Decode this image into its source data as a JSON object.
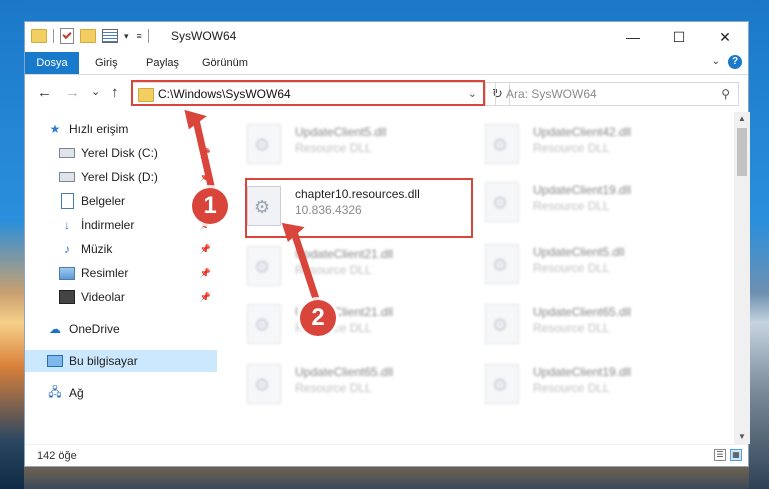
{
  "window": {
    "title": "SysWOW64",
    "controls": {
      "minimize": "—",
      "maximize": "☐",
      "close": "✕"
    }
  },
  "ribbon": {
    "tabs": [
      "Dosya",
      "Giriş",
      "Paylaş",
      "Görünüm"
    ],
    "help": "?"
  },
  "nav": {
    "back": "←",
    "forward": "→",
    "recent": "⌄",
    "up": "↑",
    "address": "C:\\Windows\\SysWOW64",
    "refresh": "↻",
    "search_placeholder": "Ara: SysWOW64"
  },
  "sidebar": {
    "quick_access": "Hızlı erişim",
    "items": [
      {
        "label": "Yerel Disk (C:)",
        "icon": "drive-icon",
        "pinned": true
      },
      {
        "label": "Yerel Disk (D:)",
        "icon": "drive-icon",
        "pinned": true
      },
      {
        "label": "Belgeler",
        "icon": "documents-icon",
        "pinned": true
      },
      {
        "label": "İndirmeler",
        "icon": "downloads-icon",
        "pinned": true
      },
      {
        "label": "Müzik",
        "icon": "music-icon",
        "pinned": true
      },
      {
        "label": "Resimler",
        "icon": "pictures-icon",
        "pinned": true
      },
      {
        "label": "Videolar",
        "icon": "videos-icon",
        "pinned": true
      }
    ],
    "onedrive": "OneDrive",
    "this_pc": "Bu bilgisayar",
    "network": "Ağ"
  },
  "files": {
    "highlighted": {
      "name": "chapter10.resources.dll",
      "desc": "10.836.4326"
    },
    "left_column": [
      {
        "name": "UpdateClient5.dll",
        "desc": "Resource DLL"
      },
      {
        "name": "UpdateClient21.dll",
        "desc": "Resource DLL"
      },
      {
        "name": "UpdateClient21.dll",
        "desc": "Resource DLL"
      },
      {
        "name": "UpdateClient65.dll",
        "desc": "Resource DLL"
      }
    ],
    "right_column": [
      {
        "name": "UpdateClient42.dll",
        "desc": "Resource DLL"
      },
      {
        "name": "UpdateClient19.dll",
        "desc": "Resource DLL"
      },
      {
        "name": "UpdateClient5.dll",
        "desc": "Resource DLL"
      },
      {
        "name": "UpdateClient65.dll",
        "desc": "Resource DLL"
      },
      {
        "name": "UpdateClient19.dll",
        "desc": "Resource DLL"
      }
    ]
  },
  "status": {
    "count": "142 öğe"
  },
  "markers": [
    "1",
    "2"
  ],
  "colors": {
    "accent": "#1979ca",
    "highlight": "#d9443b",
    "selected": "#cce8ff"
  }
}
